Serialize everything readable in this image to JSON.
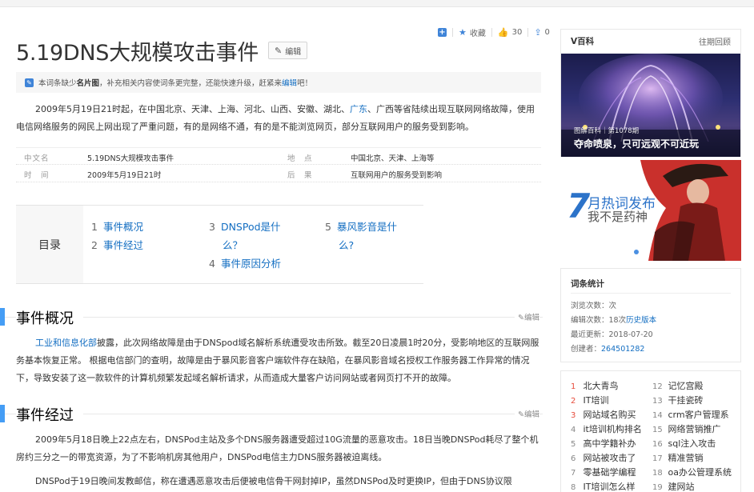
{
  "toolbar": {
    "add_label": "+",
    "fav_label": "收藏",
    "like_count": "30",
    "share_count": "0"
  },
  "title": "5.19DNS大规模攻击事件",
  "edit_label": "编辑",
  "notice": {
    "prefix": "本词条缺少",
    "bold": "名片图",
    "middle": "，补充相关内容使词条更完整，还能快速升级，赶紧来",
    "link": "编辑",
    "suffix": "吧！"
  },
  "intro": {
    "part1": "2009年5月19日21时起，在中国北京、天津、上海、河北、山西、安徽、湖北、",
    "link": "广东",
    "part2": "、广西等省陆续出现互联网网络故障，使用电信网络服务的网民上网出现了严重问题，有的是网络不通，有的是不能浏览网页，部分互联网用户的服务受到影响。"
  },
  "info": {
    "rows": [
      {
        "k1": "中文名",
        "v1": "5.19DNS大规模攻击事件",
        "k2": "地　点",
        "v2": "中国北京、天津、上海等"
      },
      {
        "k1": "时　间",
        "v1": "2009年5月19日21时",
        "k2": "后　果",
        "v2": "互联网用户的服务受到影响"
      }
    ]
  },
  "catalog": {
    "title": "目录",
    "items": [
      {
        "num": "1",
        "label": "事件概况"
      },
      {
        "num": "2",
        "label": "事件经过"
      },
      {
        "num": "3",
        "label": "DNSPod是什"
      },
      {
        "num": "",
        "label": "么？"
      },
      {
        "num": "4",
        "label": "事件原因分析"
      },
      {
        "num": "5",
        "label": "暴风影音是什"
      },
      {
        "num": "",
        "label": "么?"
      }
    ]
  },
  "sections": [
    {
      "title": "事件概况",
      "edit": "编辑"
    },
    {
      "title": "事件经过",
      "edit": "编辑"
    }
  ],
  "sec1": {
    "link": "工业和信息化部",
    "text": "披露，此次网络故障是由于DNSpod域名解析系统遭受攻击所致。截至20日凌晨1时20分，受影响地区的互联网服务基本恢复正常。 根据电信部门的查明，故障是由于暴风影音客户端软件存在缺陷，在暴风影音域名授权工作服务器工作异常的情况下，导致安装了这一款软件的计算机频繁发起域名解析请求，从而造成大量客户访问网站或者网页打不开的故障。"
  },
  "sec2": {
    "p1": "2009年5月18日晚上22点左右，DNSPod主站及多个DNS服务器遭受超过10G流量的恶意攻击。18日当晚DNSPod耗尽了整个机房约三分之一的带宽资源，为了不影响机房其他用户，DNSPod电信主力DNS服务器被迫离线。",
    "p2": "DNSPod于19日晚间发教邮信，称在遭遇恶意攻击后便被电信骨干网封掉IP，虽然DNSPod及时更换IP，但由于DNS协议限"
  },
  "vbaike": {
    "head": "V百科",
    "more": "往期回顾",
    "cap1": "图解百科｜第1078期",
    "cap2": "夺命喷泉，只可远观不可近玩"
  },
  "hot": {
    "num": "7",
    "line1": "月热词发布",
    "line2": "我不是药神"
  },
  "stats": {
    "head": "词条统计",
    "views_label": "浏览次数：",
    "views_value": "次",
    "edits_label": "编辑次数：",
    "edits_value": "18次",
    "edits_link": "历史版本",
    "updated_label": "最近更新：",
    "updated_value": "2018-07-20",
    "creator_label": "创建者：",
    "creator_value": "264501282"
  },
  "rank": {
    "left": [
      {
        "n": "1",
        "t": "北大青鸟"
      },
      {
        "n": "2",
        "t": "IT培训"
      },
      {
        "n": "3",
        "t": "网站域名购买"
      },
      {
        "n": "4",
        "t": "it培训机构排名"
      },
      {
        "n": "5",
        "t": "高中学籍补办"
      },
      {
        "n": "6",
        "t": "网站被攻击了"
      },
      {
        "n": "7",
        "t": "零基础学编程"
      },
      {
        "n": "8",
        "t": "IT培训怎么样"
      }
    ],
    "right": [
      {
        "n": "12",
        "t": "记忆宫殿"
      },
      {
        "n": "13",
        "t": "干挂瓷砖"
      },
      {
        "n": "14",
        "t": "crm客户管理系"
      },
      {
        "n": "15",
        "t": "网络营销推广"
      },
      {
        "n": "16",
        "t": "sql注入攻击"
      },
      {
        "n": "17",
        "t": "精准营销"
      },
      {
        "n": "18",
        "t": "oa办公管理系统"
      },
      {
        "n": "19",
        "t": "建网站"
      }
    ]
  }
}
